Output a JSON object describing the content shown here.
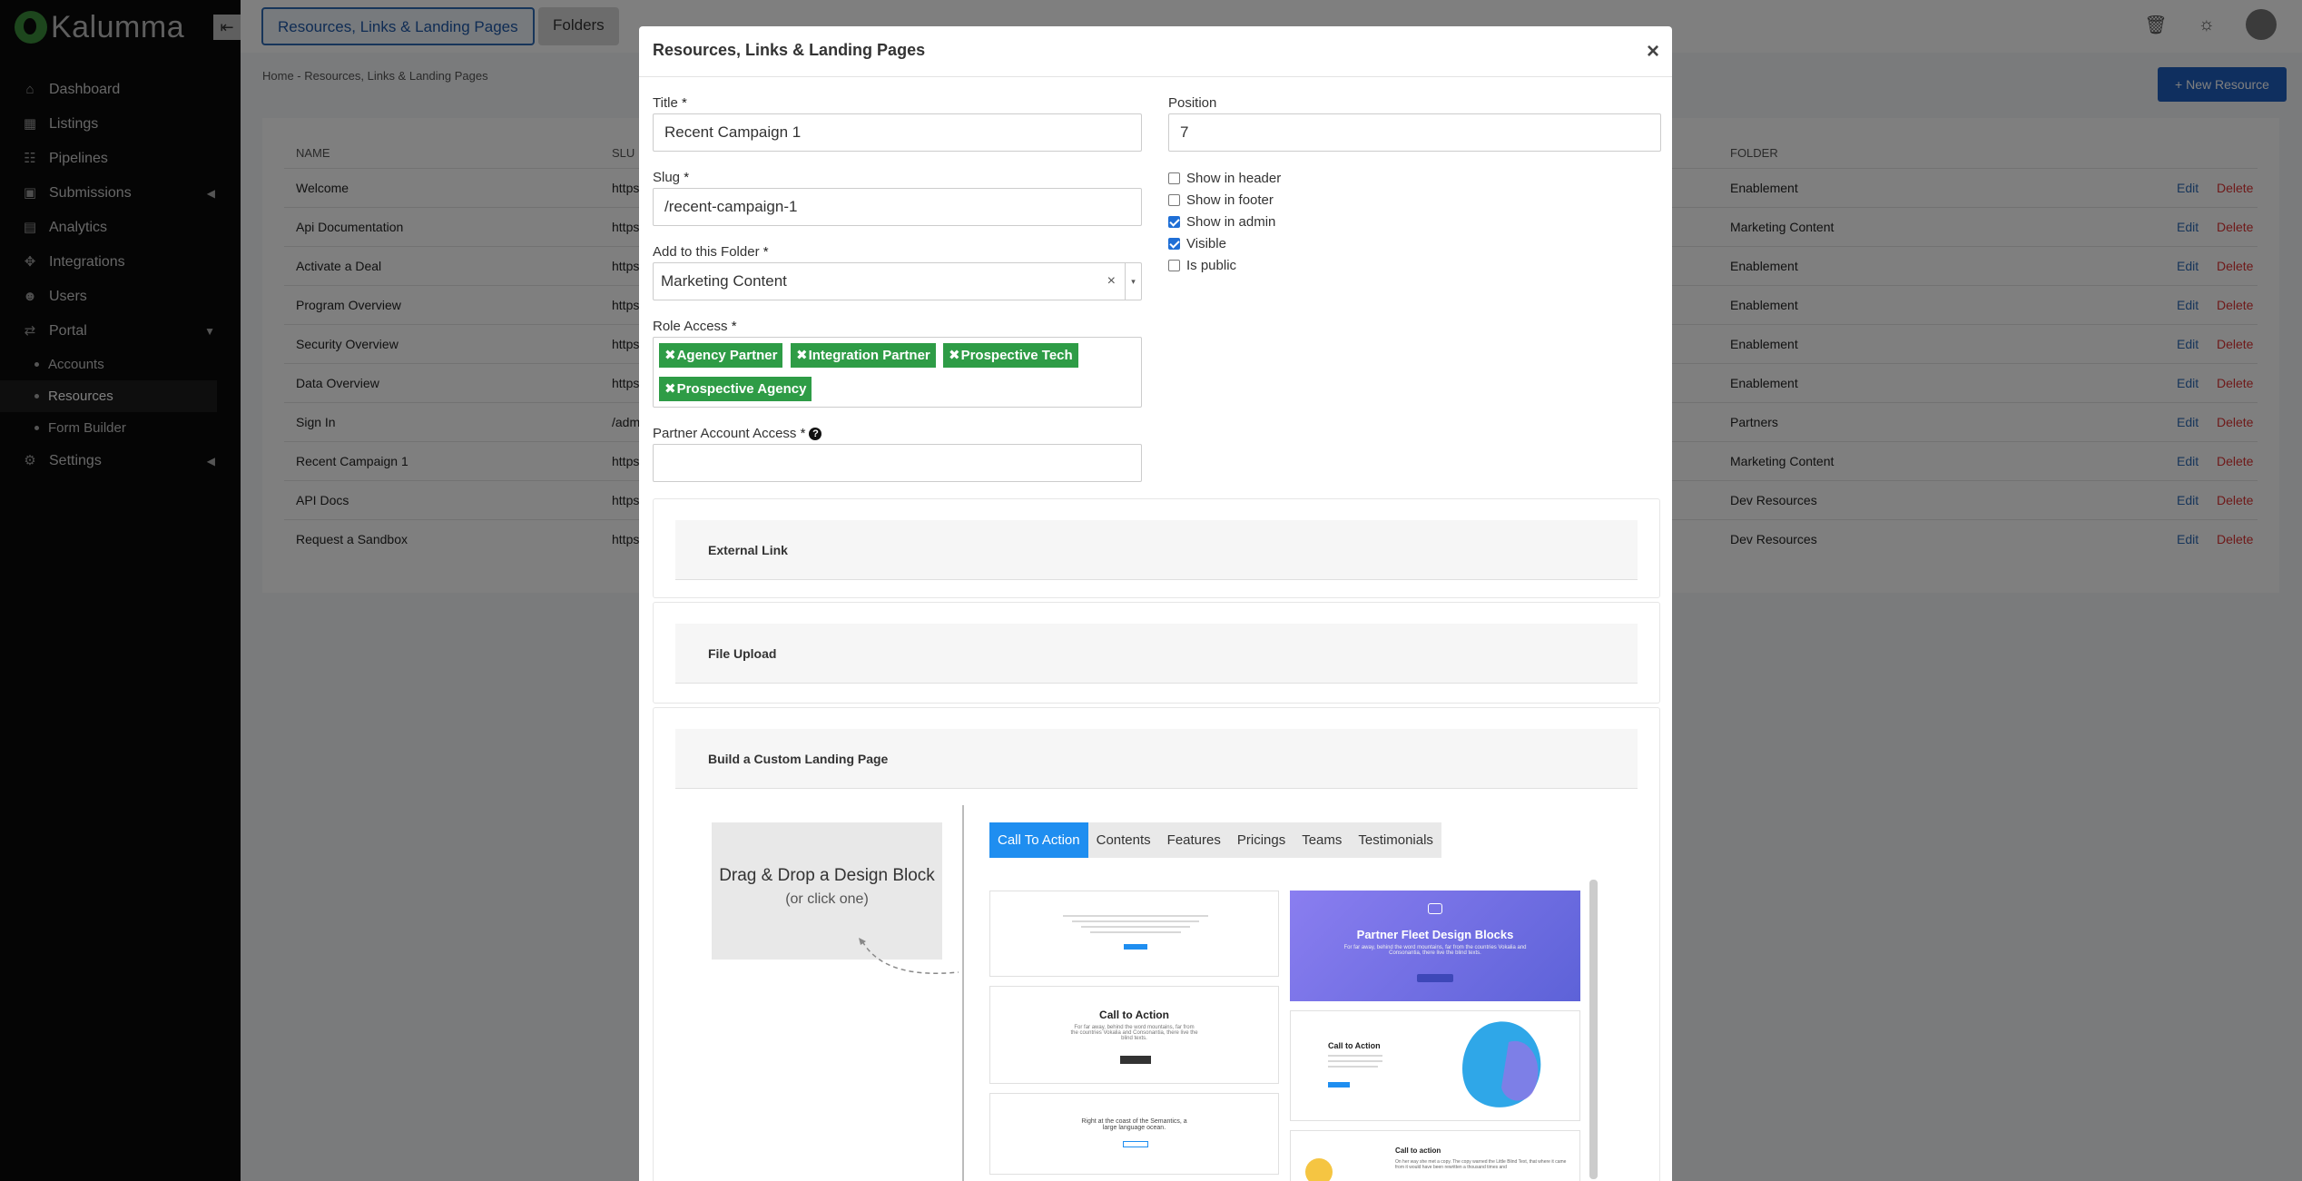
{
  "app": {
    "logo_text": "Kalumma"
  },
  "sidebar": {
    "collapse_label": "⇤",
    "items": [
      {
        "label": "Dashboard",
        "icon": "home-icon"
      },
      {
        "label": "Listings",
        "icon": "grid-icon"
      },
      {
        "label": "Pipelines",
        "icon": "pipeline-icon"
      },
      {
        "label": "Submissions",
        "icon": "inbox-icon"
      },
      {
        "label": "Analytics",
        "icon": "chart-icon"
      },
      {
        "label": "Integrations",
        "icon": "plug-icon"
      },
      {
        "label": "Users",
        "icon": "users-icon"
      },
      {
        "label": "Portal",
        "icon": "portal-icon"
      }
    ],
    "portal_children": [
      {
        "label": "Accounts"
      },
      {
        "label": "Resources"
      },
      {
        "label": "Form Builder"
      }
    ],
    "settings": {
      "label": "Settings",
      "icon": "gear-icon"
    }
  },
  "topbar": {
    "tab_active": "Resources, Links & Landing Pages",
    "tab_folders": "Folders"
  },
  "breadcrumb": "Home - Resources, Links & Landing Pages",
  "new_resource_label": "+ New Resource",
  "table": {
    "headers": {
      "name": "NAME",
      "slug": "SLU",
      "folder": "FOLDER"
    },
    "actions": {
      "edit": "Edit",
      "delete": "Delete"
    },
    "rows": [
      {
        "name": "Welcome",
        "slug": "https",
        "folder": "Enablement"
      },
      {
        "name": "Api Documentation",
        "slug": "https",
        "folder": "Marketing Content"
      },
      {
        "name": "Activate a Deal",
        "slug": "https",
        "folder": "Enablement"
      },
      {
        "name": "Program Overview",
        "slug": "https",
        "folder": "Enablement"
      },
      {
        "name": "Security Overview",
        "slug": "https",
        "folder": "Enablement"
      },
      {
        "name": "Data Overview",
        "slug": "https",
        "folder": "Enablement"
      },
      {
        "name": "Sign In",
        "slug": "/adm",
        "folder": "Partners"
      },
      {
        "name": "Recent Campaign 1",
        "slug": "https",
        "folder": "Marketing Content"
      },
      {
        "name": "API Docs",
        "slug": "https",
        "folder": "Dev Resources"
      },
      {
        "name": "Request a Sandbox",
        "slug": "https",
        "folder": "Dev Resources"
      }
    ]
  },
  "modal": {
    "title": "Resources, Links & Landing Pages",
    "close": "×",
    "title_label": "Title",
    "title_value": "Recent Campaign 1",
    "slug_label": "Slug",
    "slug_value": "/recent-campaign-1",
    "folder_label": "Add to this Folder",
    "folder_value": "Marketing Content",
    "folder_clear": "×",
    "folder_caret": "▾",
    "role_label": "Role Access",
    "roles": [
      "Agency Partner",
      "Integration Partner",
      "Prospective Tech",
      "Prospective Agency"
    ],
    "tag_remove": "✖",
    "partner_label": "Partner Account Access",
    "partner_help": "?",
    "required_mark": "*",
    "position_label": "Position",
    "position_value": "7",
    "checkboxes": [
      {
        "label": "Show in header",
        "checked": false
      },
      {
        "label": "Show in footer",
        "checked": false
      },
      {
        "label": "Show in admin",
        "checked": true
      },
      {
        "label": "Visible",
        "checked": true
      },
      {
        "label": "Is public",
        "checked": false
      }
    ],
    "sections": [
      "External Link",
      "File Upload",
      "Build a Custom Landing Page"
    ],
    "dropzone": {
      "title": "Drag & Drop a Design Block",
      "subtitle": "(or click one)"
    },
    "block_tabs": [
      "Call To Action",
      "Contents",
      "Features",
      "Pricings",
      "Teams",
      "Testimonials"
    ],
    "thumbs": {
      "cta_title": "Call to Action",
      "cta_text": "For far away, behind the word mountains, far from the countries Vokalia and Consonantia, there live the blind texts.",
      "semantics_text": "Right at the coast of the Semantics, a large language ocean.",
      "partner_fleet": "Partner Fleet Design Blocks",
      "partner_fleet_text": "For far away, behind the word mountains, far from the countries Vokalia and Consonantia, there live the blind texts.",
      "cta_left_title": "Call to Action",
      "cta_small_title": "Call to action",
      "cta_small_text": "On her way she met a copy. The copy warned the Little Blind Text, that where it came from it would have been rewritten a thousand times and"
    }
  },
  "colors": {
    "accent": "#1f5fbf",
    "tag_green": "#2e9c46",
    "delete_red": "#dd3333",
    "tab_blue": "#1f8ef0"
  }
}
